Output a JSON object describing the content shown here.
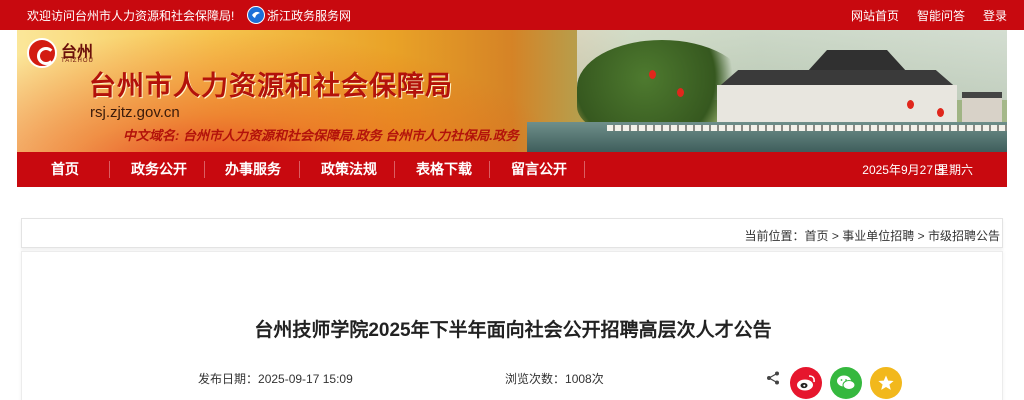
{
  "topbar": {
    "welcome": "欢迎访问台州市人力资源和社会保障局!",
    "zj_link": "浙江政务服务网",
    "links": [
      "网站首页",
      "智能问答",
      "登录"
    ]
  },
  "banner": {
    "logo_cn": "台州",
    "logo_en": "TAIZHOU",
    "title": "台州市人力资源和社会保障局",
    "domain": "rsj.zjtz.gov.cn",
    "cn_domain_label": "中文域名:",
    "cn_domain_value": "台州市人力资源和社会保障局.政务   台州市人力社保局.政务"
  },
  "nav": {
    "items": [
      "首页",
      "政务公开",
      "办事服务",
      "政策法规",
      "表格下载",
      "留言公开"
    ],
    "date": "2025年9月27日",
    "weekday": "星期六"
  },
  "breadcrumb": {
    "label": "当前位置：",
    "items": [
      "首页",
      "事业单位招聘",
      "市级招聘公告"
    ],
    "sep": ">"
  },
  "article": {
    "title": "台州技师学院2025年下半年面向社会公开招聘高层次人才公告",
    "publish_date_label": "发布日期：",
    "publish_date": "2025-09-17 15:09",
    "views_label": "浏览次数：",
    "views": "1008次"
  },
  "colors": {
    "brand_red": "#c8090f",
    "weibo": "#e6162d",
    "wechat": "#35b83e",
    "favorite": "#f2b81c"
  },
  "icons": [
    "zjzwfw-logo-icon",
    "taizhou-logo-icon",
    "share-icon",
    "weibo-icon",
    "wechat-icon",
    "favorite-star-icon"
  ]
}
